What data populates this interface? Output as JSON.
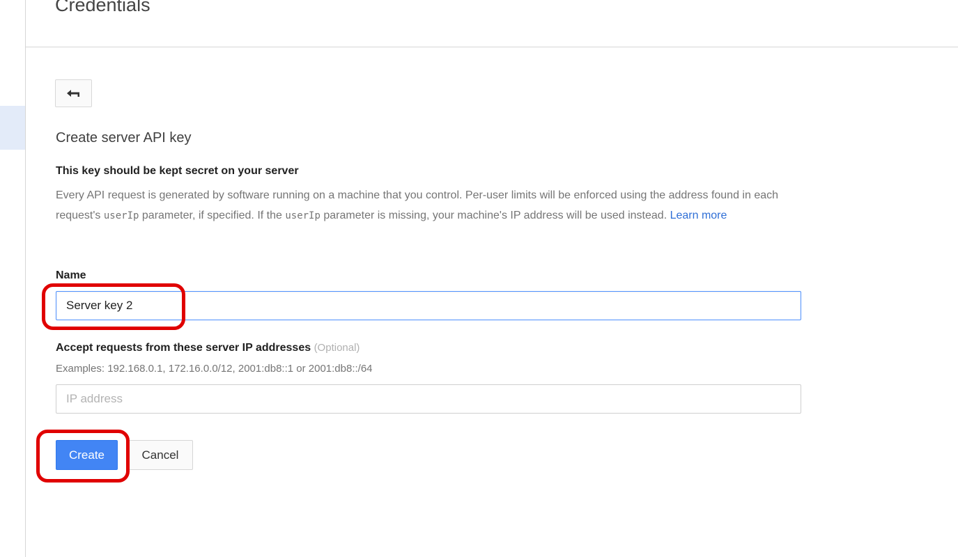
{
  "header": {
    "title": "Credentials"
  },
  "back": {
    "icon": "back-arrow-icon"
  },
  "form": {
    "title": "Create server API key",
    "warning_heading": "This key should be kept secret on your server",
    "description_part1": "Every API request is generated by software running on a machine that you control. Per-user limits will be enforced using the address found in each request's ",
    "code1": "userIp",
    "description_part2": " parameter, if specified. If the ",
    "code2": "userIp",
    "description_part3": " parameter is missing, your machine's IP address will be used instead. ",
    "learn_more": "Learn more",
    "name_label": "Name",
    "name_value": "Server key 2",
    "ip_label": "Accept requests from these server IP addresses",
    "ip_optional": "(Optional)",
    "ip_examples": "Examples: 192.168.0.1, 172.16.0.0/12, 2001:db8::1 or 2001:db8::/64",
    "ip_placeholder": "IP address",
    "create_label": "Create",
    "cancel_label": "Cancel"
  },
  "colors": {
    "accent": "#4285f4",
    "link": "#2f6fd6",
    "annotation": "#e00000"
  }
}
